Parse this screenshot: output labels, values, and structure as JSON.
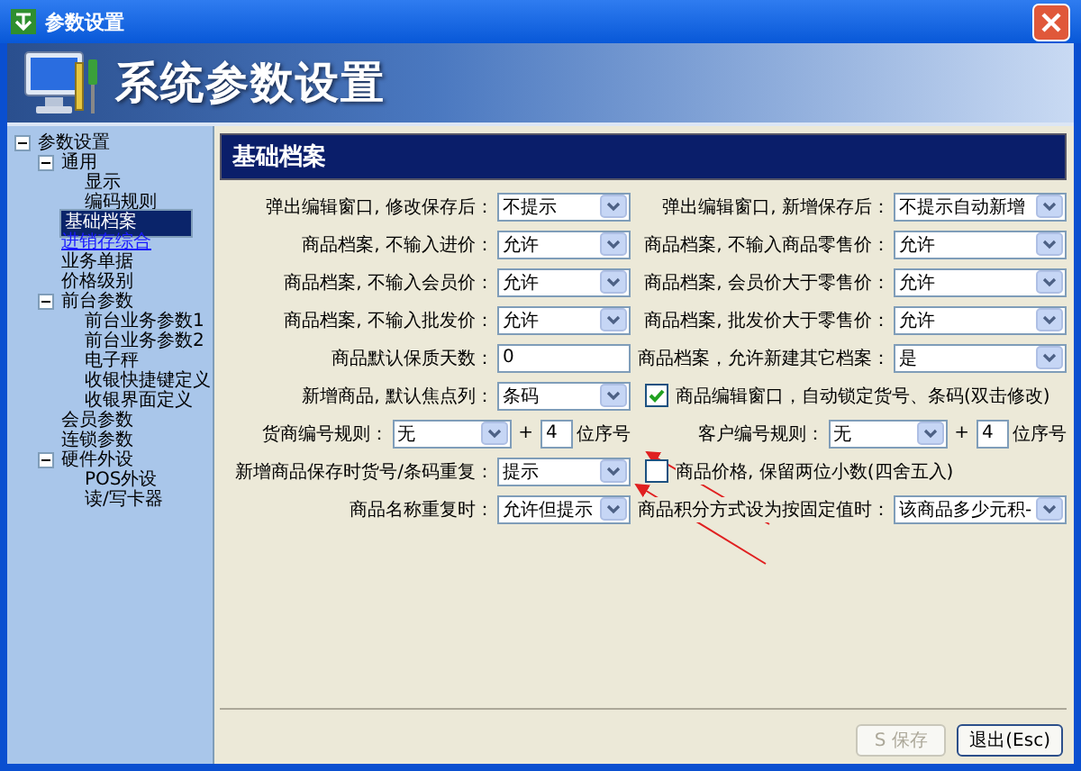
{
  "window": {
    "title": "参数设置"
  },
  "banner": {
    "title": "系统参数设置"
  },
  "tree": [
    {
      "label": "参数设置",
      "selected": false,
      "hovered": false,
      "expanded": true,
      "children": [
        {
          "label": "通用",
          "selected": false,
          "hovered": false,
          "expanded": true,
          "children": [
            {
              "label": "显示",
              "selected": false,
              "hovered": false
            },
            {
              "label": "编码规则",
              "selected": false,
              "hovered": false
            }
          ]
        },
        {
          "label": "基础档案",
          "selected": true,
          "hovered": false
        },
        {
          "label": "进销存综合",
          "selected": false,
          "hovered": true
        },
        {
          "label": "业务单据",
          "selected": false,
          "hovered": false
        },
        {
          "label": "价格级别",
          "selected": false,
          "hovered": false
        },
        {
          "label": "前台参数",
          "selected": false,
          "hovered": false,
          "expanded": true,
          "children": [
            {
              "label": "前台业务参数1",
              "selected": false,
              "hovered": false
            },
            {
              "label": "前台业务参数2",
              "selected": false,
              "hovered": false
            },
            {
              "label": "电子秤",
              "selected": false,
              "hovered": false
            },
            {
              "label": "收银快捷键定义",
              "selected": false,
              "hovered": false
            },
            {
              "label": "收银界面定义",
              "selected": false,
              "hovered": false
            }
          ]
        },
        {
          "label": "会员参数",
          "selected": false,
          "hovered": false
        },
        {
          "label": "连锁参数",
          "selected": false,
          "hovered": false
        },
        {
          "label": "硬件外设",
          "selected": false,
          "hovered": false,
          "expanded": true,
          "children": [
            {
              "label": "POS外设",
              "selected": false,
              "hovered": false
            },
            {
              "label": "读/写卡器",
              "selected": false,
              "hovered": false
            }
          ]
        }
      ]
    }
  ],
  "panel": {
    "title": "基础档案",
    "rows": [
      {
        "left": {
          "kind": "select",
          "label": "弹出编辑窗口, 修改保存后：",
          "value": "不提示"
        },
        "right": {
          "kind": "select",
          "label": "弹出编辑窗口, 新增保存后：",
          "value": "不提示自动新增"
        }
      },
      {
        "left": {
          "kind": "select",
          "label": "商品档案, 不输入进价：",
          "value": "允许"
        },
        "right": {
          "kind": "select",
          "label": "商品档案, 不输入商品零售价：",
          "value": "允许"
        }
      },
      {
        "left": {
          "kind": "select",
          "label": "商品档案, 不输入会员价：",
          "value": "允许"
        },
        "right": {
          "kind": "select",
          "label": "商品档案, 会员价大于零售价：",
          "value": "允许"
        }
      },
      {
        "left": {
          "kind": "select",
          "label": "商品档案, 不输入批发价：",
          "value": "允许"
        },
        "right": {
          "kind": "select",
          "label": "商品档案, 批发价大于零售价：",
          "value": "允许"
        }
      },
      {
        "left": {
          "kind": "input",
          "label": "商品默认保质天数：",
          "value": "0"
        },
        "right": {
          "kind": "select",
          "label": "商品档案，允许新建其它档案：",
          "value": "是"
        }
      },
      {
        "left": {
          "kind": "select",
          "label": "新增商品, 默认焦点列：",
          "value": "条码"
        },
        "right": {
          "kind": "checkbox",
          "label": "商品编辑窗口，自动锁定货号、条码(双击修改)",
          "checked": true
        }
      },
      {
        "left": {
          "kind": "numbering",
          "label": "货商编号规则：",
          "value": "无",
          "plus": "+",
          "digits": "4",
          "suffix": "位序号"
        },
        "right": {
          "kind": "numbering",
          "label": "客户编号规则：",
          "value": "无",
          "plus": "+",
          "digits": "4",
          "suffix": "位序号"
        }
      },
      {
        "left": {
          "kind": "select",
          "label": "新增商品保存时货号/条码重复：",
          "value": "提示"
        },
        "right": {
          "kind": "checkbox",
          "label": "商品价格, 保留两位小数(四舍五入)",
          "checked": false
        }
      },
      {
        "left": {
          "kind": "select",
          "label": "商品名称重复时：",
          "value": "允许但提示"
        },
        "right": {
          "kind": "select",
          "label": "商品积分方式设为按固定值时：",
          "value": "该商品多少元积-"
        }
      }
    ]
  },
  "buttons": [
    {
      "label": "S 保存",
      "disabled": true
    },
    {
      "label": "退出(Esc)",
      "disabled": false
    }
  ]
}
